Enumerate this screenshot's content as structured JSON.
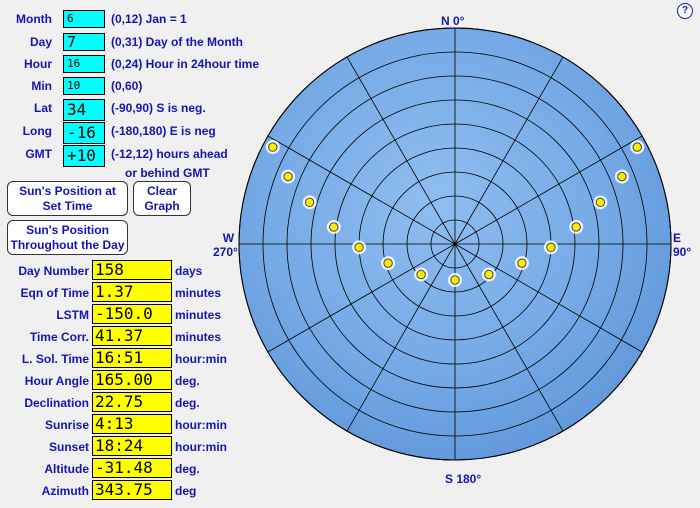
{
  "inputs": [
    {
      "key": "month",
      "label": "Month",
      "value": "6",
      "hint": "(0,12) Jan = 1"
    },
    {
      "key": "day",
      "label": "Day",
      "value": "7",
      "hint": "(0,31) Day of the Month"
    },
    {
      "key": "hour",
      "label": "Hour",
      "value": "16",
      "hint": "(0,24) Hour in 24hour time"
    },
    {
      "key": "min",
      "label": "Min",
      "value": "10",
      "hint": "(0,60)"
    },
    {
      "key": "lat",
      "label": "Lat",
      "value": "34",
      "hint": "(-90,90) S is neg."
    },
    {
      "key": "long",
      "label": "Long",
      "value": "-16",
      "hint": "(-180,180) E is neg"
    },
    {
      "key": "gmt",
      "label": "GMT",
      "value": "+10",
      "hint": "(-12,12) hours ahead"
    }
  ],
  "gmt_hint_cont": "or behind GMT",
  "buttons": {
    "set_time": [
      "Sun's Position at",
      "Set Time"
    ],
    "clear_graph": [
      "Clear",
      "Graph"
    ],
    "throughout_day": [
      "Sun's Position",
      "Throughout the Day"
    ]
  },
  "results": [
    {
      "label": "Day Number",
      "value": "158",
      "unit": "days"
    },
    {
      "label": "Eqn of Time",
      "value": "1.37",
      "unit": "minutes"
    },
    {
      "label": "LSTM",
      "value": "-150.0",
      "unit": "minutes"
    },
    {
      "label": "Time Corr.",
      "value": "41.37",
      "unit": "minutes"
    },
    {
      "label": "L. Sol. Time",
      "value": "16:51",
      "unit": "hour:min"
    },
    {
      "label": "Hour Angle",
      "value": "165.00",
      "unit": "deg."
    },
    {
      "label": "Declination",
      "value": "22.75",
      "unit": "deg."
    },
    {
      "label": "Sunrise",
      "value": "4:13",
      "unit": "hour:min"
    },
    {
      "label": "Sunset",
      "value": "18:24",
      "unit": "hour:min"
    },
    {
      "label": "Altitude",
      "value": "-31.48",
      "unit": "deg."
    },
    {
      "label": "Azimuth",
      "value": "343.75",
      "unit": "deg"
    }
  ],
  "compass": {
    "north": "N 0°",
    "south": "S 180°",
    "west": [
      "W",
      "270°"
    ],
    "east": [
      "E",
      "90°"
    ]
  },
  "help_label": "?",
  "colors": {
    "label_text": "#1414b4",
    "input_bg": "#00ffff",
    "output_bg": "#ffff00",
    "plot_fill": "#7fb0ea",
    "sun_marker": "#ffee00"
  },
  "sun_positions": [
    {
      "az": 62,
      "alt": 4
    },
    {
      "az": 68,
      "alt": 15
    },
    {
      "az": 74,
      "alt": 27
    },
    {
      "az": 82,
      "alt": 39
    },
    {
      "az": 92,
      "alt": 50
    },
    {
      "az": 106,
      "alt": 61
    },
    {
      "az": 132,
      "alt": 71
    },
    {
      "az": 180,
      "alt": 75
    },
    {
      "az": 228,
      "alt": 71
    },
    {
      "az": 254,
      "alt": 61
    },
    {
      "az": 268,
      "alt": 50
    },
    {
      "az": 278,
      "alt": 39
    },
    {
      "az": 286,
      "alt": 27
    },
    {
      "az": 292,
      "alt": 15
    },
    {
      "az": 298,
      "alt": 4
    }
  ]
}
